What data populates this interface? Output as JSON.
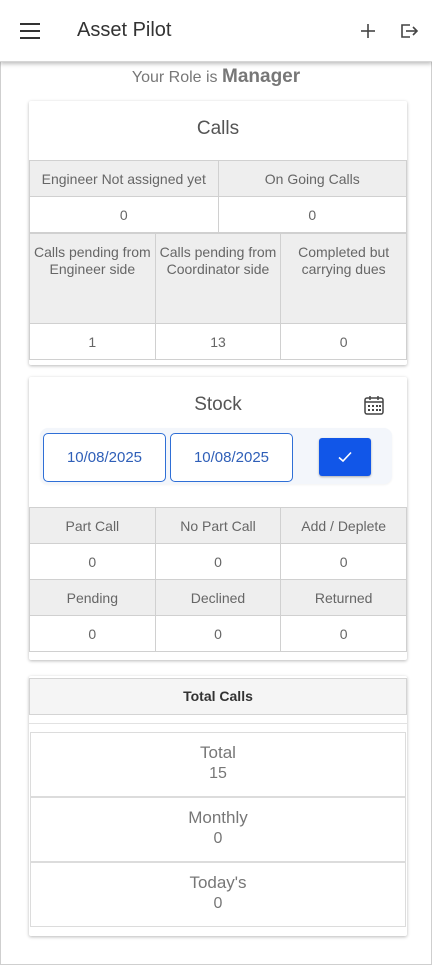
{
  "app": {
    "title": "Asset Pilot"
  },
  "role": {
    "prefix": "Your Role is",
    "name": "Manager"
  },
  "calls": {
    "title": "Calls",
    "not_assigned_label": "Engineer Not assigned yet",
    "ongoing_label": "On Going Calls",
    "not_assigned_value": "0",
    "ongoing_value": "0",
    "pending_engineer_label": "Calls pending from Engineer side",
    "pending_coordinator_label": "Calls pending from Coordinator side",
    "completed_dues_label": "Completed but carrying dues",
    "pending_engineer_value": "1",
    "pending_coordinator_value": "13",
    "completed_dues_value": "0"
  },
  "stock": {
    "title": "Stock",
    "from_date": "10/08/2025",
    "to_date": "10/08/2025",
    "headers_row1": [
      "Part Call",
      "No Part Call",
      "Add / Deplete"
    ],
    "values_row1": [
      "0",
      "0",
      "0"
    ],
    "headers_row2": [
      "Pending",
      "Declined",
      "Returned"
    ],
    "values_row2": [
      "0",
      "0",
      "0"
    ]
  },
  "total_calls": {
    "title": "Total Calls",
    "total_label": "Total",
    "total_value": "15",
    "monthly_label": "Monthly",
    "monthly_value": "0",
    "today_label": "Today's",
    "today_value": "0"
  },
  "icons": {
    "menu": "hamburger-menu-icon",
    "add": "plus-icon",
    "logout": "logout-icon",
    "calendar": "calendar-icon",
    "confirm": "checkmark-icon"
  },
  "colors": {
    "accent": "#1156e8",
    "date_text": "#2f5fb8",
    "header_cell": "#eeeeee"
  }
}
